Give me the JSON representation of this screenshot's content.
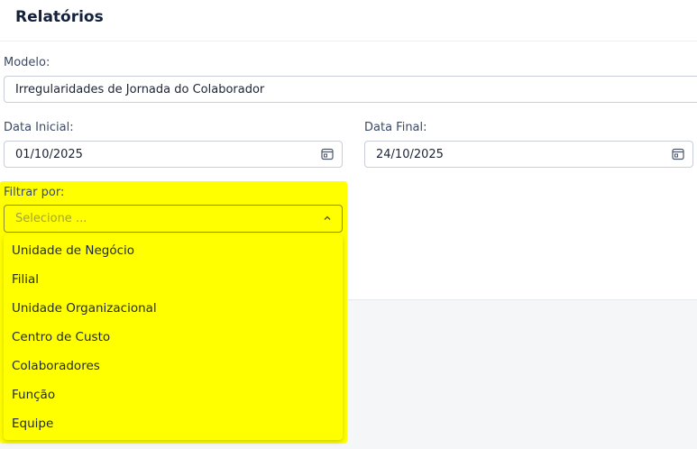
{
  "header": {
    "title": "Relatórios"
  },
  "form": {
    "model_label": "Modelo:",
    "model_value": "Irregularidades de Jornada do Colaborador",
    "start_label": "Data Inicial:",
    "start_value": "01/10/2025",
    "end_label": "Data Final:",
    "end_value": "24/10/2025",
    "filter_label": "Filtrar por:",
    "filter_placeholder": "Selecione ...",
    "filter_options": [
      "Unidade de Negócio",
      "Filial",
      "Unidade Organizacional",
      "Centro de Custo",
      "Colaboradores",
      "Função",
      "Equipe"
    ]
  },
  "icons": {
    "date_icon": "calendar-icon",
    "select_icon": "chevron-up-icon"
  },
  "colors": {
    "highlight": "#ffff00",
    "title": "#14213d",
    "label": "#3b4a66"
  }
}
